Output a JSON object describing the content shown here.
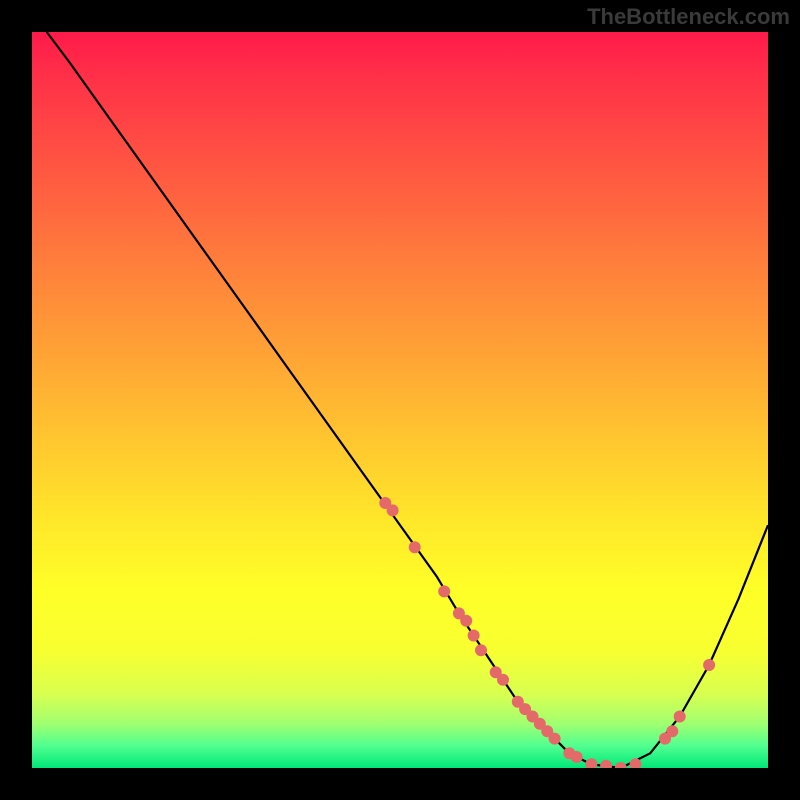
{
  "watermark": "TheBottleneck.com",
  "chart_data": {
    "type": "line",
    "title": "",
    "xlabel": "",
    "ylabel": "",
    "xlim": [
      0,
      100
    ],
    "ylim": [
      0,
      100
    ],
    "curve": {
      "x": [
        2,
        5,
        10,
        15,
        20,
        25,
        30,
        35,
        40,
        45,
        50,
        55,
        58,
        62,
        66,
        70,
        73,
        76,
        80,
        84,
        88,
        92,
        96,
        100
      ],
      "y": [
        100,
        96,
        89,
        82,
        75,
        68,
        61,
        54,
        47,
        40,
        33,
        26,
        21,
        15,
        9,
        5,
        2,
        0.5,
        0,
        2,
        7,
        14,
        23,
        33
      ]
    },
    "points": {
      "x": [
        48,
        49,
        52,
        56,
        58,
        59,
        60,
        61,
        63,
        64,
        66,
        67,
        68,
        69,
        70,
        71,
        73,
        74,
        76,
        78,
        80,
        82,
        86,
        87,
        88,
        92
      ],
      "y": [
        36,
        35,
        30,
        24,
        21,
        20,
        18,
        16,
        13,
        12,
        9,
        8,
        7,
        6,
        5,
        4,
        2,
        1.5,
        0.5,
        0.3,
        0,
        0.5,
        4,
        5,
        7,
        14
      ]
    },
    "gradient_stops": [
      {
        "pos": 0,
        "color": "#ff1a4a"
      },
      {
        "pos": 50,
        "color": "#ffc230"
      },
      {
        "pos": 85,
        "color": "#ffff28"
      },
      {
        "pos": 100,
        "color": "#00e878"
      }
    ]
  }
}
